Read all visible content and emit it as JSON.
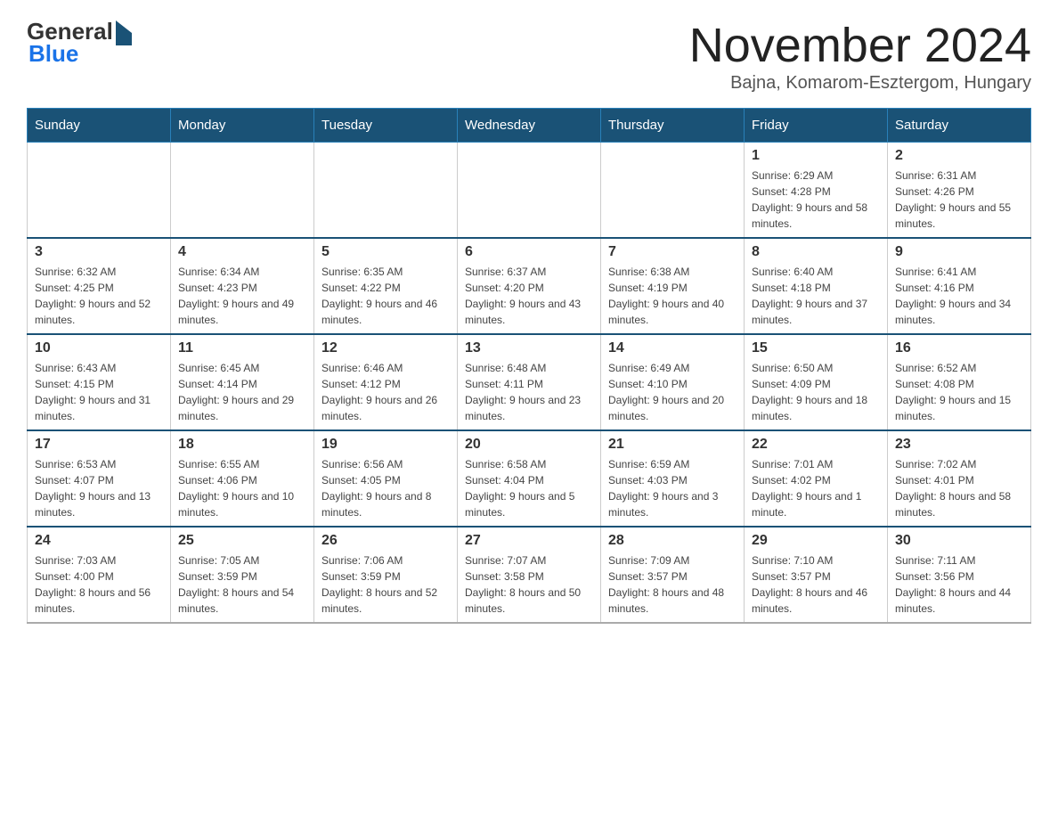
{
  "header": {
    "logo_general": "General",
    "logo_blue": "Blue",
    "title": "November 2024",
    "subtitle": "Bajna, Komarom-Esztergom, Hungary"
  },
  "calendar": {
    "days_of_week": [
      "Sunday",
      "Monday",
      "Tuesday",
      "Wednesday",
      "Thursday",
      "Friday",
      "Saturday"
    ],
    "weeks": [
      [
        {
          "day": "",
          "info": ""
        },
        {
          "day": "",
          "info": ""
        },
        {
          "day": "",
          "info": ""
        },
        {
          "day": "",
          "info": ""
        },
        {
          "day": "",
          "info": ""
        },
        {
          "day": "1",
          "info": "Sunrise: 6:29 AM\nSunset: 4:28 PM\nDaylight: 9 hours and 58 minutes."
        },
        {
          "day": "2",
          "info": "Sunrise: 6:31 AM\nSunset: 4:26 PM\nDaylight: 9 hours and 55 minutes."
        }
      ],
      [
        {
          "day": "3",
          "info": "Sunrise: 6:32 AM\nSunset: 4:25 PM\nDaylight: 9 hours and 52 minutes."
        },
        {
          "day": "4",
          "info": "Sunrise: 6:34 AM\nSunset: 4:23 PM\nDaylight: 9 hours and 49 minutes."
        },
        {
          "day": "5",
          "info": "Sunrise: 6:35 AM\nSunset: 4:22 PM\nDaylight: 9 hours and 46 minutes."
        },
        {
          "day": "6",
          "info": "Sunrise: 6:37 AM\nSunset: 4:20 PM\nDaylight: 9 hours and 43 minutes."
        },
        {
          "day": "7",
          "info": "Sunrise: 6:38 AM\nSunset: 4:19 PM\nDaylight: 9 hours and 40 minutes."
        },
        {
          "day": "8",
          "info": "Sunrise: 6:40 AM\nSunset: 4:18 PM\nDaylight: 9 hours and 37 minutes."
        },
        {
          "day": "9",
          "info": "Sunrise: 6:41 AM\nSunset: 4:16 PM\nDaylight: 9 hours and 34 minutes."
        }
      ],
      [
        {
          "day": "10",
          "info": "Sunrise: 6:43 AM\nSunset: 4:15 PM\nDaylight: 9 hours and 31 minutes."
        },
        {
          "day": "11",
          "info": "Sunrise: 6:45 AM\nSunset: 4:14 PM\nDaylight: 9 hours and 29 minutes."
        },
        {
          "day": "12",
          "info": "Sunrise: 6:46 AM\nSunset: 4:12 PM\nDaylight: 9 hours and 26 minutes."
        },
        {
          "day": "13",
          "info": "Sunrise: 6:48 AM\nSunset: 4:11 PM\nDaylight: 9 hours and 23 minutes."
        },
        {
          "day": "14",
          "info": "Sunrise: 6:49 AM\nSunset: 4:10 PM\nDaylight: 9 hours and 20 minutes."
        },
        {
          "day": "15",
          "info": "Sunrise: 6:50 AM\nSunset: 4:09 PM\nDaylight: 9 hours and 18 minutes."
        },
        {
          "day": "16",
          "info": "Sunrise: 6:52 AM\nSunset: 4:08 PM\nDaylight: 9 hours and 15 minutes."
        }
      ],
      [
        {
          "day": "17",
          "info": "Sunrise: 6:53 AM\nSunset: 4:07 PM\nDaylight: 9 hours and 13 minutes."
        },
        {
          "day": "18",
          "info": "Sunrise: 6:55 AM\nSunset: 4:06 PM\nDaylight: 9 hours and 10 minutes."
        },
        {
          "day": "19",
          "info": "Sunrise: 6:56 AM\nSunset: 4:05 PM\nDaylight: 9 hours and 8 minutes."
        },
        {
          "day": "20",
          "info": "Sunrise: 6:58 AM\nSunset: 4:04 PM\nDaylight: 9 hours and 5 minutes."
        },
        {
          "day": "21",
          "info": "Sunrise: 6:59 AM\nSunset: 4:03 PM\nDaylight: 9 hours and 3 minutes."
        },
        {
          "day": "22",
          "info": "Sunrise: 7:01 AM\nSunset: 4:02 PM\nDaylight: 9 hours and 1 minute."
        },
        {
          "day": "23",
          "info": "Sunrise: 7:02 AM\nSunset: 4:01 PM\nDaylight: 8 hours and 58 minutes."
        }
      ],
      [
        {
          "day": "24",
          "info": "Sunrise: 7:03 AM\nSunset: 4:00 PM\nDaylight: 8 hours and 56 minutes."
        },
        {
          "day": "25",
          "info": "Sunrise: 7:05 AM\nSunset: 3:59 PM\nDaylight: 8 hours and 54 minutes."
        },
        {
          "day": "26",
          "info": "Sunrise: 7:06 AM\nSunset: 3:59 PM\nDaylight: 8 hours and 52 minutes."
        },
        {
          "day": "27",
          "info": "Sunrise: 7:07 AM\nSunset: 3:58 PM\nDaylight: 8 hours and 50 minutes."
        },
        {
          "day": "28",
          "info": "Sunrise: 7:09 AM\nSunset: 3:57 PM\nDaylight: 8 hours and 48 minutes."
        },
        {
          "day": "29",
          "info": "Sunrise: 7:10 AM\nSunset: 3:57 PM\nDaylight: 8 hours and 46 minutes."
        },
        {
          "day": "30",
          "info": "Sunrise: 7:11 AM\nSunset: 3:56 PM\nDaylight: 8 hours and 44 minutes."
        }
      ]
    ]
  }
}
